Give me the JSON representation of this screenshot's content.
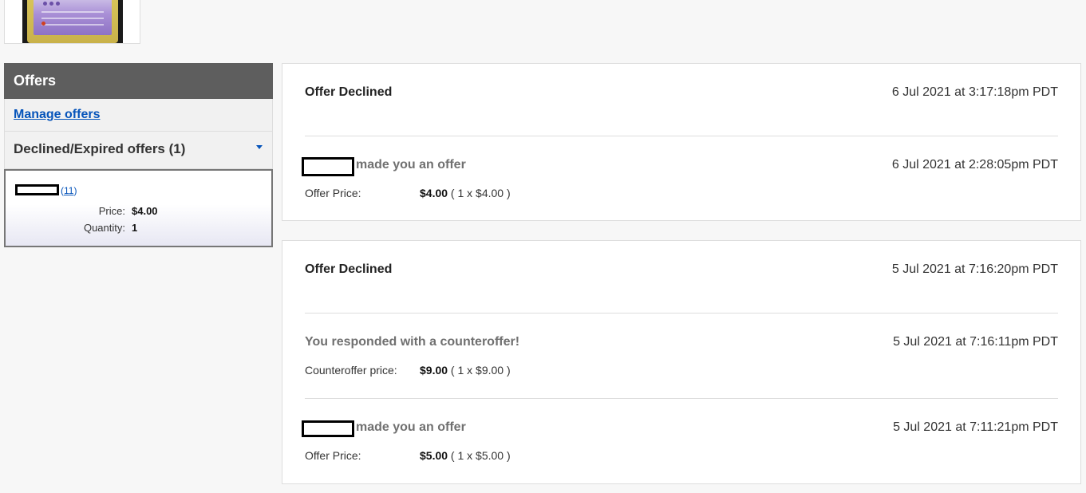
{
  "sidebar": {
    "header": "Offers",
    "manage_link": "Manage offers",
    "section_title": "Declined/Expired offers (1)",
    "offer": {
      "feedback_open": "(",
      "feedback_score": "11",
      "feedback_close": ")",
      "price_label": "Price:",
      "price_value": "$4.00",
      "quantity_label": "Quantity:",
      "quantity_value": "1"
    }
  },
  "threads": [
    {
      "status": "Offer Declined",
      "status_time": "6 Jul 2021 at 3:17:18pm PDT",
      "events": [
        {
          "title": "made you an offer",
          "time": "6 Jul 2021 at 2:28:05pm PDT",
          "price_label": "Offer Price:",
          "price_amount": "$4.00",
          "price_detail": " ( 1 x $4.00 )"
        }
      ]
    },
    {
      "status": "Offer Declined",
      "status_time": "5 Jul 2021 at 7:16:20pm PDT",
      "events": [
        {
          "title": "You responded with a counteroffer!",
          "time": "5 Jul 2021 at 7:16:11pm PDT",
          "price_label": "Counteroffer price:",
          "price_amount": "$9.00",
          "price_detail": " ( 1 x $9.00 )"
        },
        {
          "title": "made you an offer",
          "time": "5 Jul 2021 at 7:11:21pm PDT",
          "price_label": "Offer Price:",
          "price_amount": "$5.00",
          "price_detail": " ( 1 x $5.00 )"
        }
      ]
    }
  ]
}
